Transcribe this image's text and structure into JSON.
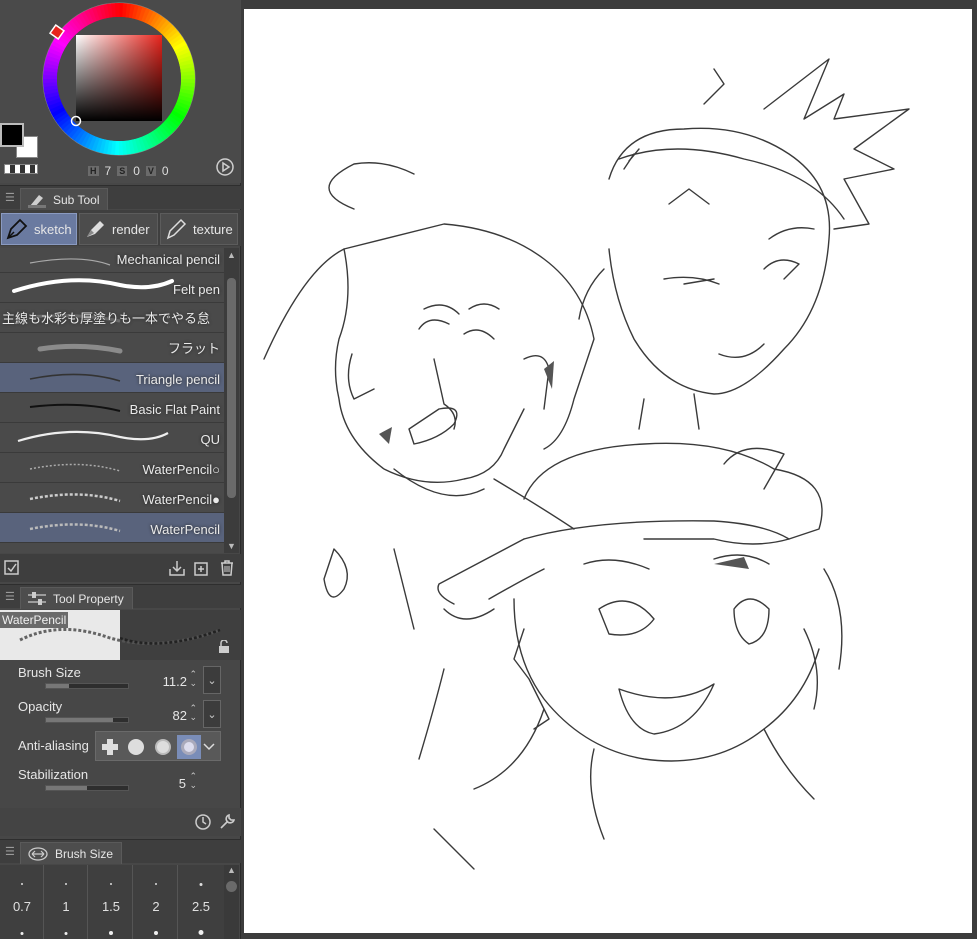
{
  "color": {
    "hsv": {
      "h_label": "H",
      "h_value": "7",
      "s_label": "S",
      "s_value": "0",
      "v_label": "V",
      "v_value": "0"
    },
    "main_color": "#000000",
    "sub_color": "#ffffff",
    "hue_color": "#e8241c"
  },
  "subtool_panel": {
    "title": "Sub Tool",
    "tabs": [
      {
        "label": "sketch",
        "icon": "pen-nib-icon",
        "active": true
      },
      {
        "label": "render",
        "icon": "marker-icon",
        "active": false
      },
      {
        "label": "texture",
        "icon": "pencil-icon",
        "active": false
      }
    ],
    "brushes": [
      {
        "name": "Mechanical pencil",
        "selected": false
      },
      {
        "name": "Felt pen",
        "selected": false
      },
      {
        "name": "主線も水彩も厚塗りも一本でやる怠",
        "selected": false
      },
      {
        "name": "フラット",
        "selected": false
      },
      {
        "name": "Triangle pencil",
        "selected": true
      },
      {
        "name": "Basic Flat Paint",
        "selected": false
      },
      {
        "name": "QU",
        "selected": false
      },
      {
        "name": "WaterPencil○",
        "selected": false
      },
      {
        "name": "WaterPencil●",
        "selected": false
      },
      {
        "name": "WaterPencil",
        "selected": true
      }
    ]
  },
  "tool_property": {
    "title": "Tool Property",
    "preview_label": "WaterPencil",
    "brush_size": {
      "label": "Brush Size",
      "value": "11.2",
      "fraction": 0.28
    },
    "opacity": {
      "label": "Opacity",
      "value": "82",
      "fraction": 0.82
    },
    "anti_aliasing": {
      "label": "Anti-aliasing",
      "selected_index": 3
    },
    "stabilization": {
      "label": "Stabilization",
      "value": "5",
      "fraction": 0.5
    }
  },
  "brush_size_panel": {
    "title": "Brush Size",
    "sizes": [
      "0.7",
      "1",
      "1.5",
      "2",
      "2.5"
    ]
  }
}
